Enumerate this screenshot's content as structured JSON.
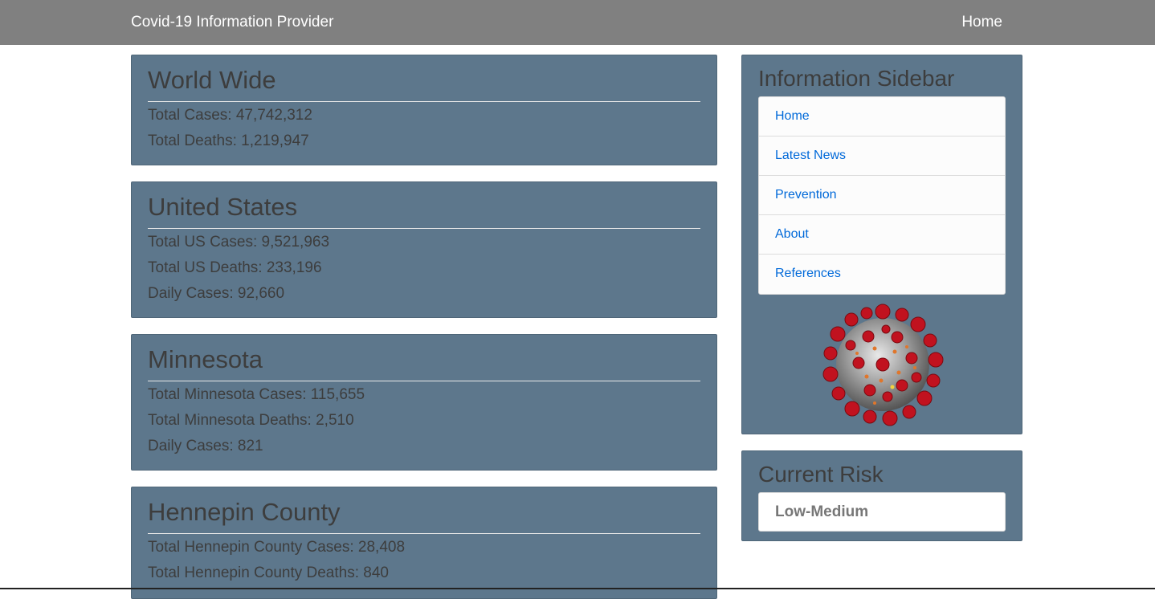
{
  "navbar": {
    "brand": "Covid-19 Information Provider",
    "home_link": "Home"
  },
  "world": {
    "title": "World Wide",
    "total_cases": "Total Cases: 47,742,312",
    "total_deaths": "Total Deaths: 1,219,947"
  },
  "us": {
    "title": "United States",
    "total_cases": "Total US Cases: 9,521,963",
    "total_deaths": "Total US Deaths: 233,196",
    "daily_cases": "Daily Cases: 92,660"
  },
  "minnesota": {
    "title": "Minnesota",
    "total_cases": "Total Minnesota Cases: 115,655",
    "total_deaths": "Total Minnesota Deaths: 2,510",
    "daily_cases": "Daily Cases: 821"
  },
  "hennepin": {
    "title": "Hennepin County",
    "total_cases": "Total Hennepin County Cases: 28,408",
    "total_deaths": "Total Hennepin County Deaths: 840"
  },
  "sidebar": {
    "title": "Information Sidebar",
    "items": [
      {
        "label": "Home"
      },
      {
        "label": "Latest News"
      },
      {
        "label": "Prevention"
      },
      {
        "label": "About"
      },
      {
        "label": "References"
      }
    ],
    "image_icon": "coronavirus-virion-icon"
  },
  "risk": {
    "title": "Current Risk",
    "level": "Low-Medium"
  },
  "colors": {
    "navbar": "#808080",
    "card": "#5d778c",
    "link": "#0069d9",
    "text": "#3d3d3d"
  }
}
